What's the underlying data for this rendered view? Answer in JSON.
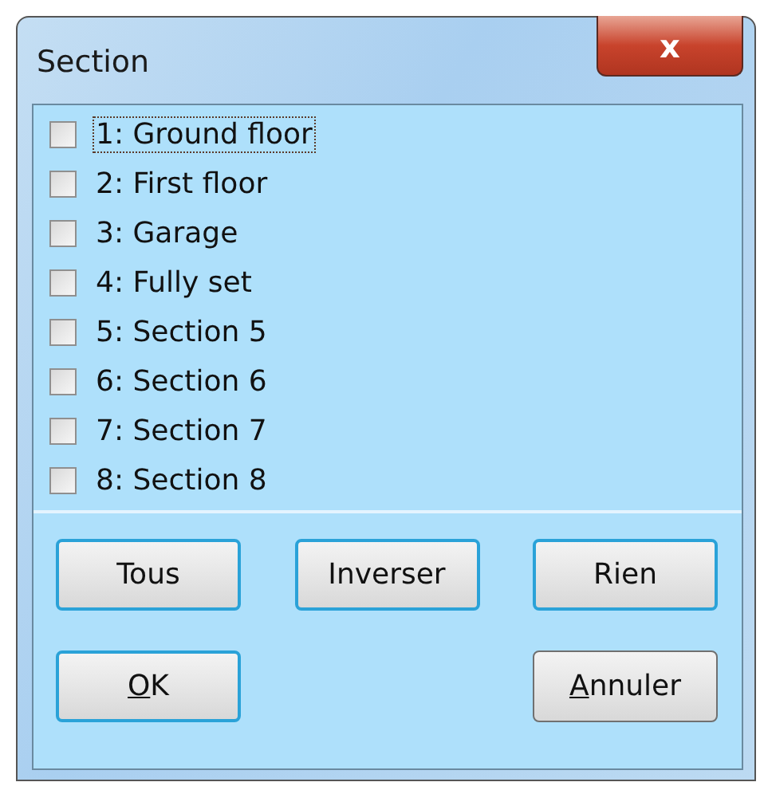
{
  "window": {
    "title": "Section",
    "close": "x"
  },
  "items": [
    {
      "label": "1: Ground floor",
      "checked": false,
      "focused": true
    },
    {
      "label": "2: First floor",
      "checked": false,
      "focused": false
    },
    {
      "label": "3: Garage",
      "checked": false,
      "focused": false
    },
    {
      "label": "4: Fully set",
      "checked": false,
      "focused": false
    },
    {
      "label": "5: Section 5",
      "checked": false,
      "focused": false
    },
    {
      "label": "6: Section 6",
      "checked": false,
      "focused": false
    },
    {
      "label": "7: Section 7",
      "checked": false,
      "focused": false
    },
    {
      "label": "8: Section 8",
      "checked": false,
      "focused": false
    }
  ],
  "select_buttons": [
    {
      "label": "Tous",
      "default": true
    },
    {
      "label": "Inverser",
      "default": true
    },
    {
      "label": "Rien",
      "default": true
    }
  ],
  "dialog_buttons": [
    {
      "accel": "O",
      "rest": "K",
      "default": true
    },
    {
      "accel": "A",
      "rest": "nnuler",
      "default": false
    }
  ]
}
